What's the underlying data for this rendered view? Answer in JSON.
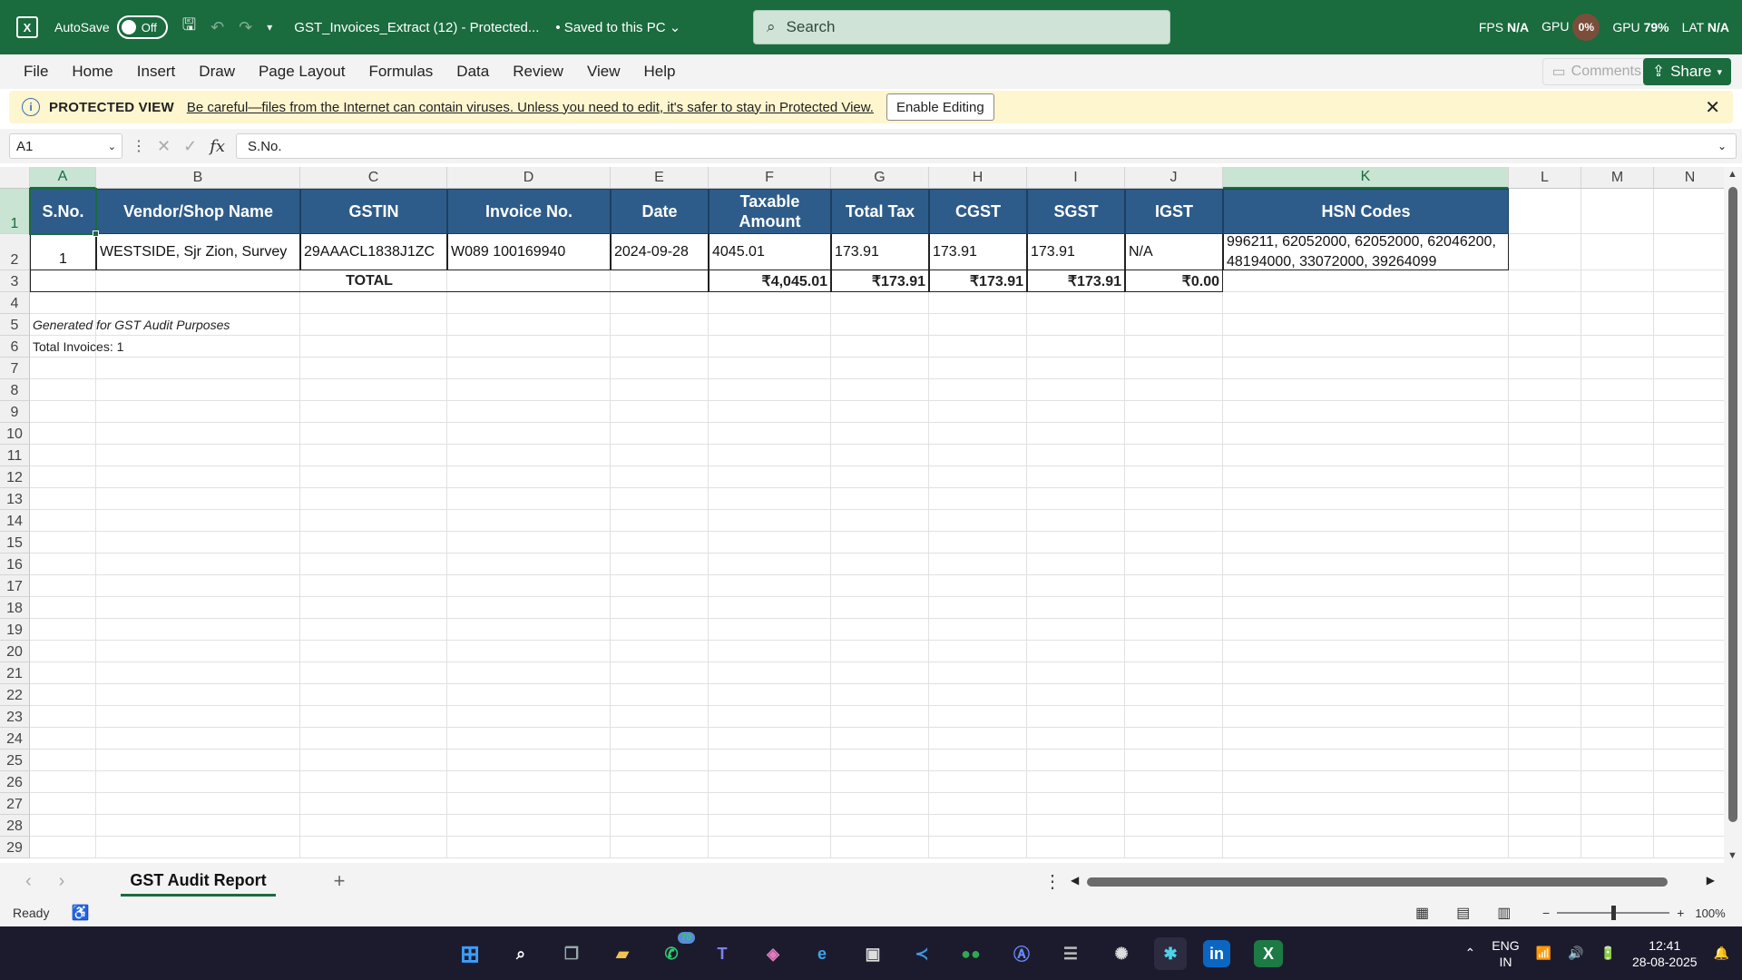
{
  "titlebar": {
    "autosave_label": "AutoSave",
    "autosave_state": "Off",
    "doc_title": "GST_Invoices_Extract (12)  -  Protected...",
    "saved_status": "• Saved to this PC",
    "search_placeholder": "Search",
    "perf": {
      "fps_label": "FPS",
      "fps_value": "N/A",
      "gpu_label": "GPU",
      "gpu_value": "0%",
      "gpu2_label": "GPU",
      "gpu2_value": "79%",
      "lat_label": "LAT",
      "lat_value": "N/A"
    }
  },
  "menu": {
    "items": [
      "File",
      "Home",
      "Insert",
      "Draw",
      "Page Layout",
      "Formulas",
      "Data",
      "Review",
      "View",
      "Help"
    ],
    "comments": "Comments",
    "share": "Share"
  },
  "protected_view": {
    "label": "PROTECTED VIEW",
    "message": "Be careful—files from the Internet can contain viruses. Unless you need to edit, it's safer to stay in Protected View.",
    "enable_button": "Enable Editing"
  },
  "formula_bar": {
    "name_box": "A1",
    "formula": "S.No."
  },
  "columns": [
    "A",
    "B",
    "C",
    "D",
    "E",
    "F",
    "G",
    "H",
    "I",
    "J",
    "K",
    "L",
    "M",
    "N"
  ],
  "rows": [
    "1",
    "2",
    "3",
    "4",
    "5",
    "6",
    "7",
    "8",
    "9",
    "10",
    "11",
    "12",
    "13",
    "14",
    "15",
    "16",
    "17",
    "18",
    "19",
    "20",
    "21",
    "22",
    "23",
    "24",
    "25",
    "26",
    "27",
    "28",
    "29"
  ],
  "sheet": {
    "headers": [
      "S.No.",
      "Vendor/Shop Name",
      "GSTIN",
      "Invoice No.",
      "Date",
      "Taxable Amount",
      "Total Tax",
      "CGST",
      "SGST",
      "IGST",
      "HSN Codes"
    ],
    "row2": {
      "sno": "1",
      "vendor": "WESTSIDE, Sjr Zion, Survey",
      "gstin": "29AAACL1838J1ZC",
      "invoice_no": "W089 100169940",
      "date": "2024-09-28",
      "taxable": "4045.01",
      "total_tax": "173.91",
      "cgst": "173.91",
      "sgst": "173.91",
      "igst": "N/A",
      "hsn": "996211, 62052000, 62052000, 62046200, 48194000, 33072000, 39264099"
    },
    "totals": {
      "label": "TOTAL",
      "taxable": "₹4,045.01",
      "total_tax": "₹173.91",
      "cgst": "₹173.91",
      "sgst": "₹173.91",
      "igst": "₹0.00"
    },
    "note1": "Generated for GST Audit Purposes",
    "note2": "Total Invoices: 1"
  },
  "sheet_tabs": {
    "active": "GST Audit Report"
  },
  "status": {
    "ready": "Ready",
    "zoom": "100%"
  },
  "taskbar": {
    "whatsapp_badge": "70",
    "lang_line1": "ENG",
    "lang_line2": "IN",
    "time": "12:41",
    "date": "28-08-2025"
  },
  "colors": {
    "excel_green": "#1a6b3e",
    "header_blue": "#2e5c8a",
    "protected_yellow": "#fdf6cf"
  }
}
